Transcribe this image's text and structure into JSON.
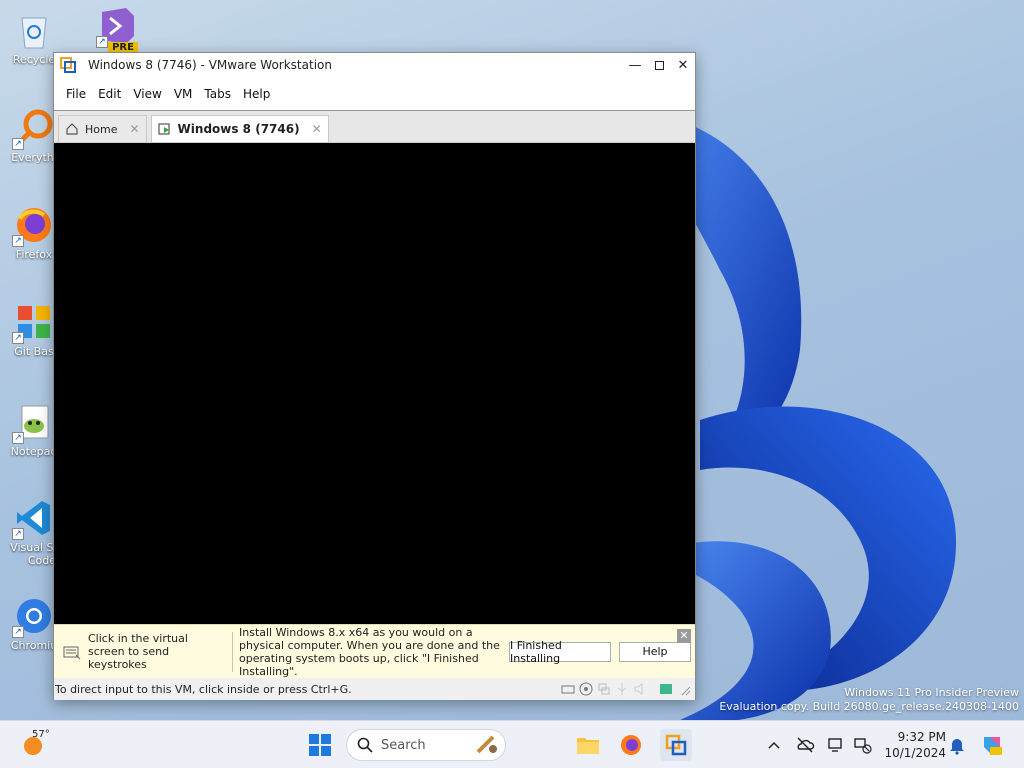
{
  "desktop": {
    "icons": [
      {
        "label": "Recycle"
      },
      {
        "label": "PRE"
      },
      {
        "label": "Everythi"
      },
      {
        "label": "Firefox"
      },
      {
        "label": "Git Bas"
      },
      {
        "label": "Notepad"
      },
      {
        "label": "Visual St",
        "label2": "Code"
      },
      {
        "label": "Chromiu"
      }
    ],
    "watermark": {
      "line1": "Windows 11 Pro Insider Preview",
      "line2": "Evaluation copy. Build 26080.ge_release.240308-1400"
    }
  },
  "window": {
    "title": "Windows 8 (7746) - VMware Workstation",
    "menu": [
      "File",
      "Edit",
      "View",
      "VM",
      "Tabs",
      "Help"
    ],
    "tabs": [
      {
        "label": "Home"
      },
      {
        "label": "Windows 8 (7746)"
      }
    ],
    "notification": {
      "hint": "Click in the virtual screen to send keystrokes",
      "message": "Install Windows 8.x x64 as you would on a physical computer. When you are done and the operating system boots up, click \"I Finished Installing\".",
      "finished_button": "I Finished Installing",
      "help_button": "Help"
    },
    "status_text": "To direct input to this VM, click inside or press Ctrl+G."
  },
  "taskbar": {
    "weather_temp": "57°",
    "search_placeholder": "Search",
    "time": "9:32 PM",
    "date": "10/1/2024"
  },
  "colors": {
    "accent": "#1f5fbf",
    "notify_bg": "#fffbdf"
  }
}
